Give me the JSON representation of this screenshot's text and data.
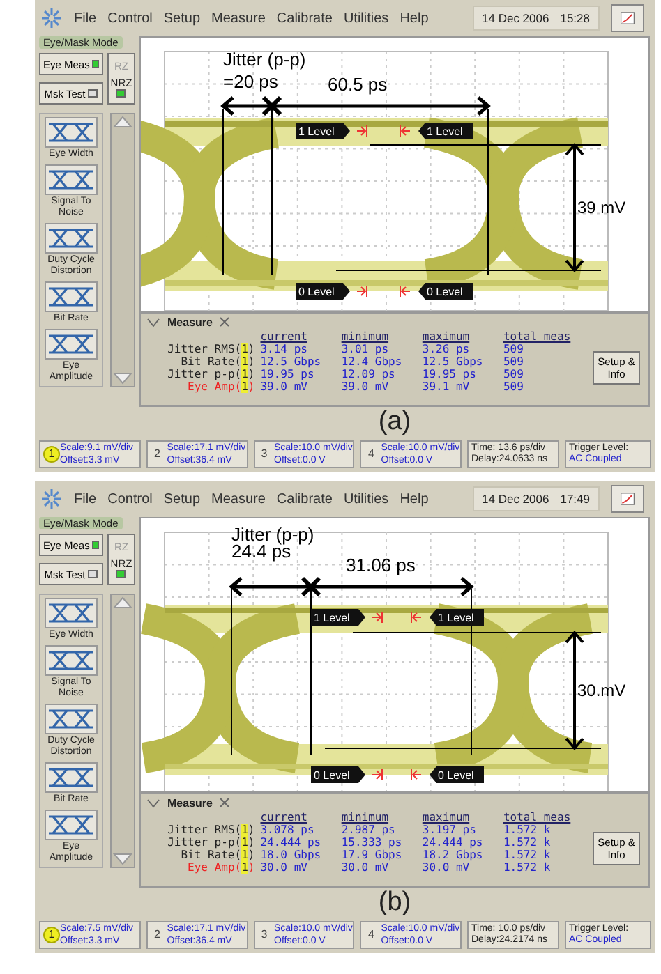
{
  "panels": [
    {
      "menu": [
        "File",
        "Control",
        "Setup",
        "Measure",
        "Calibrate",
        "Utilities",
        "Help"
      ],
      "date": "14 Dec 2006",
      "time": "15:28",
      "mode_title": "Eye/Mask Mode",
      "mode_buttons": [
        {
          "label": "Eye Meas",
          "selected": true
        },
        {
          "label": "Msk Test",
          "selected": false
        }
      ],
      "format_buttons": [
        {
          "label": "RZ",
          "selected": false
        },
        {
          "label": "NRZ",
          "selected": true
        }
      ],
      "tools": [
        "Eye Width",
        "Signal To Noise",
        "Duty Cycle Distortion",
        "Bit Rate",
        "Eye Amplitude"
      ],
      "annotations": {
        "jitter_title": "Jitter (p-p)",
        "jitter_value": "=20 ps",
        "eye_width": "60.5 ps",
        "eye_amplitude": "39 mV"
      },
      "level_markers": [
        "1 Level",
        "1 Level",
        "0 Level",
        "0 Level"
      ],
      "measure": {
        "title": "Measure",
        "columns": [
          "current",
          "minimum",
          "maximum",
          "total meas"
        ],
        "rows": [
          {
            "name": "Jitter RMS(",
            "channel": "1",
            "close": ")",
            "highlighted": false,
            "values": [
              "3.14 ps",
              "3.01 ps",
              "3.26 ps",
              "509"
            ]
          },
          {
            "name": "Bit Rate(",
            "channel": "1",
            "close": ")",
            "highlighted": false,
            "values": [
              "12.5 Gbps",
              "12.4 Gbps",
              "12.5 Gbps",
              "509"
            ]
          },
          {
            "name": "Jitter p-p(",
            "channel": "1",
            "close": ")",
            "highlighted": false,
            "values": [
              "19.95 ps",
              "12.09 ps",
              "19.95 ps",
              "509"
            ]
          },
          {
            "name": "Eye Amp(",
            "channel": "1",
            "close": ")",
            "highlighted": true,
            "values": [
              "39.0 mV",
              "39.0 mV",
              "39.1 mV",
              "509"
            ]
          }
        ],
        "button": "Setup & Info"
      },
      "caption": "(a)",
      "channels": [
        {
          "number": "1",
          "scale": "Scale:9.1 mV/div",
          "offset": "Offset:3.3 mV",
          "selected": true
        },
        {
          "number": "2",
          "scale": "Scale:17.1 mV/div",
          "offset": "Offset:36.4 mV",
          "selected": false
        },
        {
          "number": "3",
          "scale": "Scale:10.0 mV/div",
          "offset": "Offset:0.0 V",
          "selected": false
        },
        {
          "number": "4",
          "scale": "Scale:10.0 mV/div",
          "offset": "Offset:0.0 V",
          "selected": false
        }
      ],
      "timebase": {
        "time": "Time: 13.6 ps/div",
        "delay": "Delay:24.0633 ns"
      },
      "trigger": {
        "label": "Trigger Level:",
        "value": "AC Coupled"
      }
    },
    {
      "menu": [
        "File",
        "Control",
        "Setup",
        "Measure",
        "Calibrate",
        "Utilities",
        "Help"
      ],
      "date": "14 Dec 2006",
      "time": "17:49",
      "mode_title": "Eye/Mask Mode",
      "mode_buttons": [
        {
          "label": "Eye Meas",
          "selected": true
        },
        {
          "label": "Msk Test",
          "selected": false
        }
      ],
      "format_buttons": [
        {
          "label": "RZ",
          "selected": false
        },
        {
          "label": "NRZ",
          "selected": true
        }
      ],
      "tools": [
        "Eye Width",
        "Signal To Noise",
        "Duty Cycle Distortion",
        "Bit Rate",
        "Eye Amplitude"
      ],
      "annotations": {
        "jitter_title": "Jitter (p-p)",
        "jitter_value": "24.4 ps",
        "eye_width": "31.06 ps",
        "eye_amplitude": "30.mV"
      },
      "level_markers": [
        "1 Level",
        "1 Level",
        "0 Level",
        "0 Level"
      ],
      "measure": {
        "title": "Measure",
        "columns": [
          "current",
          "minimum",
          "maximum",
          "total meas"
        ],
        "rows": [
          {
            "name": "Jitter RMS(",
            "channel": "1",
            "close": ")",
            "highlighted": false,
            "values": [
              "3.078 ps",
              "2.987 ps",
              "3.197 ps",
              "1.572 k"
            ]
          },
          {
            "name": "Jitter p-p(",
            "channel": "1",
            "close": ")",
            "highlighted": false,
            "values": [
              "24.444 ps",
              "15.333 ps",
              "24.444 ps",
              "1.572 k"
            ]
          },
          {
            "name": "Bit Rate(",
            "channel": "1",
            "close": ")",
            "highlighted": false,
            "values": [
              "18.0 Gbps",
              "17.9 Gbps",
              "18.2 Gbps",
              "1.572 k"
            ]
          },
          {
            "name": "Eye Amp(",
            "channel": "1",
            "close": ")",
            "highlighted": true,
            "values": [
              "30.0 mV",
              "30.0 mV",
              "30.0 mV",
              "1.572 k"
            ]
          }
        ],
        "button": "Setup & Info"
      },
      "caption": "(b)",
      "channels": [
        {
          "number": "1",
          "scale": "Scale:7.5 mV/div",
          "offset": "Offset:3.3 mV",
          "selected": true
        },
        {
          "number": "2",
          "scale": "Scale:17.1 mV/div",
          "offset": "Offset:36.4 mV",
          "selected": false
        },
        {
          "number": "3",
          "scale": "Scale:10.0 mV/div",
          "offset": "Offset:0.0 V",
          "selected": false
        },
        {
          "number": "4",
          "scale": "Scale:10.0 mV/div",
          "offset": "Offset:0.0 V",
          "selected": false
        }
      ],
      "timebase": {
        "time": "Time: 10.0 ps/div",
        "delay": "Delay:24.2174 ns"
      },
      "trigger": {
        "label": "Trigger Level:",
        "value": "AC Coupled"
      }
    }
  ]
}
